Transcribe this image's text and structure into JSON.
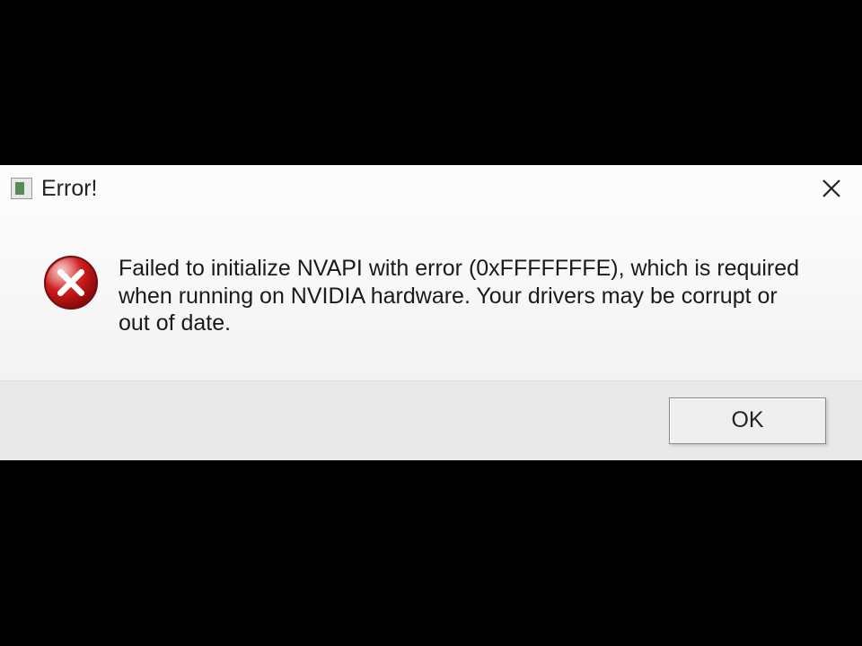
{
  "dialog": {
    "title": "Error!",
    "message": "Failed to initialize NVAPI with error (0xFFFFFFFE), which is required when running on NVIDIA hardware. Your drivers may be corrupt or out of date.",
    "ok_label": "OK"
  }
}
